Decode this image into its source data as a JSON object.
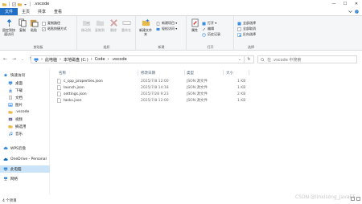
{
  "window": {
    "title": ".vscode",
    "minimize": "—",
    "maximize": "☐",
    "close": "✕"
  },
  "tabs": [
    {
      "label": "文件",
      "active": true
    },
    {
      "label": "主页"
    },
    {
      "label": "共享"
    },
    {
      "label": "查看"
    }
  ],
  "ribbon": {
    "pin_label": "固定到快速访问",
    "copy_label": "复制",
    "paste_label": "粘贴",
    "copy_path_label": "复制路径",
    "paste_shortcut_label": "粘贴快捷方式",
    "clipboard_group": "剪贴板",
    "move_to_label": "移动到",
    "copy_to_label": "复制到",
    "delete_label": "删除",
    "rename_label": "重命名",
    "organize_group": "组织",
    "new_folder_label": "新建文件夹",
    "new_item_label": "新建项目 ▾",
    "easy_access_label": "轻松访问 ▾",
    "new_group": "新建",
    "properties_label": "属性",
    "open_label": "打开 ▾",
    "edit_label": "编辑",
    "history_label": "历史记录",
    "open_group": "打开",
    "select_all_label": "全部选择",
    "select_none_label": "全部取消",
    "invert_selection_label": "反向选择",
    "select_group": "选择"
  },
  "address": {
    "path": [
      "此电脑",
      "本地磁盘 (C:)",
      "Code",
      ".vscode"
    ],
    "search_placeholder": "在 .vscode 中搜索"
  },
  "navpane": {
    "items": [
      {
        "label": "快速访问",
        "icon": "star-icon",
        "color": "#2b7cd3"
      },
      {
        "label": "桌面",
        "icon": "desktop-icon",
        "color": "#3a8ee6"
      },
      {
        "label": "下载",
        "icon": "download-icon",
        "color": "#2b7cd3"
      },
      {
        "label": "文档",
        "icon": "document-icon",
        "color": "#8a8a8a"
      },
      {
        "label": "图片",
        "icon": "picture-icon",
        "color": "#3a8ee6"
      },
      {
        "label": ".vscode",
        "icon": "folder-icon",
        "color": "#e8b848"
      },
      {
        "label": "视频",
        "icon": "video-icon",
        "color": "#6b6b9b"
      },
      {
        "label": "摘选用",
        "icon": "folder-icon",
        "color": "#e8b848"
      },
      {
        "label": "音乐",
        "icon": "music-icon",
        "color": "#2b7cd3"
      },
      {
        "label": "WPS云盘",
        "icon": "cloud-icon",
        "color": "#3a8ee6"
      },
      {
        "label": "OneDrive - Personal",
        "icon": "onedrive-icon",
        "color": "#0f6cbd"
      },
      {
        "label": "此电脑",
        "icon": "computer-icon",
        "color": "#3a8ee6",
        "selected": true
      },
      {
        "label": "网络",
        "icon": "network-icon",
        "color": "#3a8ee6"
      }
    ]
  },
  "columns": {
    "name": "名称",
    "modified": "修改日期",
    "type": "类型",
    "size": "大小"
  },
  "files": [
    {
      "name": "c_cpp_properties.json",
      "modified": "2025/7/8 12:00",
      "type": "JSON 源文件",
      "size": "1 KB"
    },
    {
      "name": "launch.json",
      "modified": "2025/7/8 14:18",
      "type": "JSON 源文件",
      "size": "1 KB"
    },
    {
      "name": "settings.json",
      "modified": "2025/7/28 9:23",
      "type": "JSON 源文件",
      "size": "2 KB"
    },
    {
      "name": "tasks.json",
      "modified": "2025/7/8 12:00",
      "type": "JSON 源文件",
      "size": "1 KB"
    }
  ],
  "status": {
    "count": "4 个项目",
    "watermark": "CSDN @linxisong_JavaEE"
  }
}
